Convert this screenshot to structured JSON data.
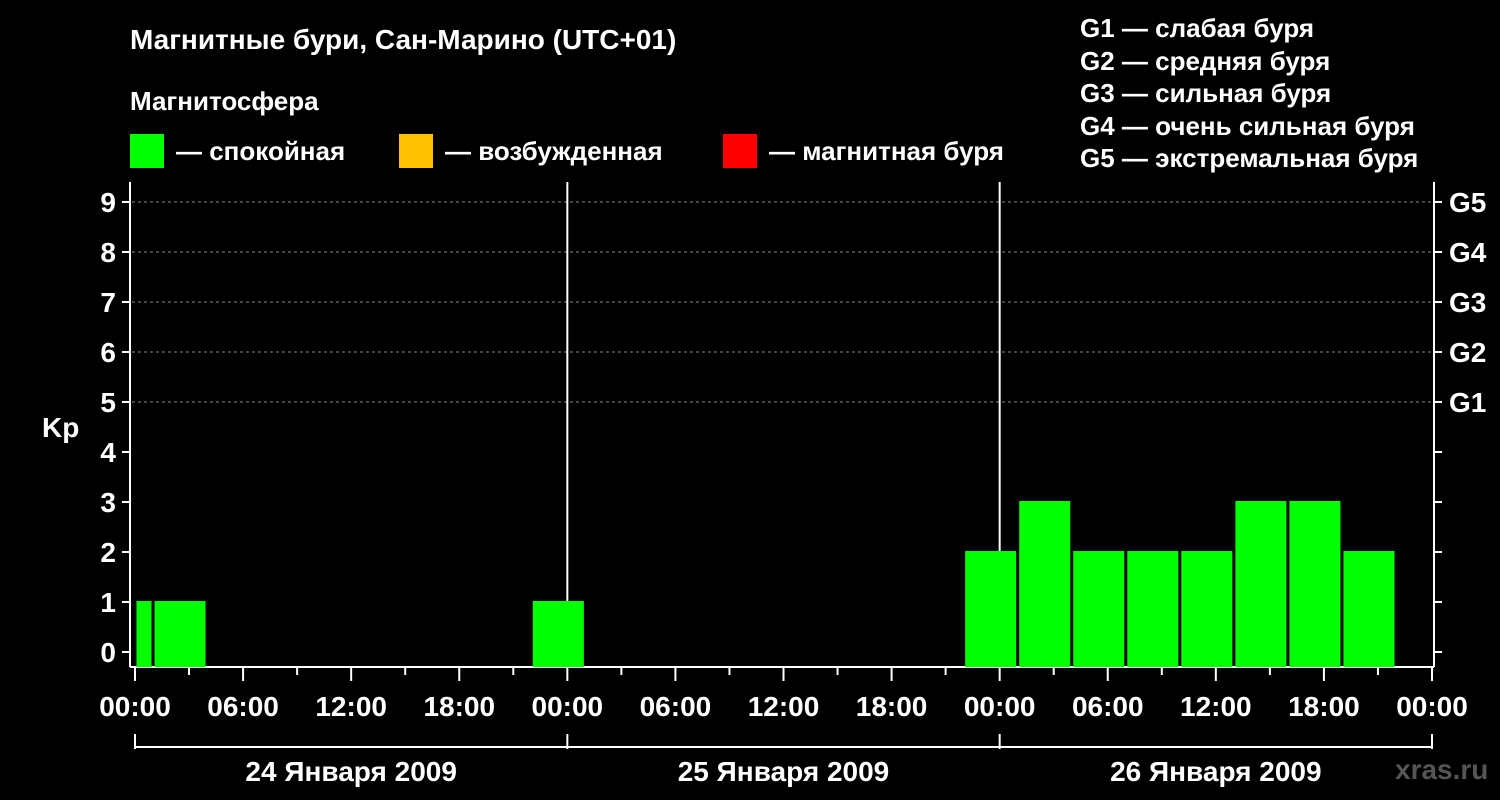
{
  "title": "Магнитные бури, Сан-Марино (UTC+01)",
  "magnetosphere_label": "Магнитосфера",
  "legend": [
    {
      "label": "— спокойная",
      "color": "#00ff00"
    },
    {
      "label": "— возбужденная",
      "color": "#ffc000"
    },
    {
      "label": "— магнитная буря",
      "color": "#ff0000"
    }
  ],
  "g_scale": [
    "G1 — слабая буря",
    "G2 — средняя буря",
    "G3 — сильная буря",
    "G4 — очень сильная буря",
    "G5 — экстремальная буря"
  ],
  "watermark": "xras.ru",
  "chart_data": {
    "type": "bar",
    "ylabel": "Kp",
    "ylim": [
      0,
      9
    ],
    "y_ticks": [
      "0",
      "1",
      "2",
      "3",
      "4",
      "5",
      "6",
      "7",
      "8",
      "9"
    ],
    "right_ticks": [
      {
        "kp": 5,
        "label": "G1"
      },
      {
        "kp": 6,
        "label": "G2"
      },
      {
        "kp": 7,
        "label": "G3"
      },
      {
        "kp": 8,
        "label": "G4"
      },
      {
        "kp": 9,
        "label": "G5"
      }
    ],
    "x_tick_labels": [
      "00:00",
      "06:00",
      "12:00",
      "18:00",
      "00:00",
      "06:00",
      "12:00",
      "18:00",
      "00:00",
      "06:00",
      "12:00",
      "18:00",
      "00:00"
    ],
    "days": [
      "24 Января 2009",
      "25 Января 2009",
      "26 Января 2009"
    ],
    "grid": "horizontal dashed at Kp 5-9",
    "bars": [
      {
        "start_hour": 0,
        "end_hour": 1,
        "kp": 1
      },
      {
        "start_hour": 1,
        "end_hour": 4,
        "kp": 1
      },
      {
        "start_hour": 22,
        "end_hour": 25,
        "kp": 1
      },
      {
        "start_hour": 46,
        "end_hour": 49,
        "kp": 2
      },
      {
        "start_hour": 49,
        "end_hour": 52,
        "kp": 3
      },
      {
        "start_hour": 52,
        "end_hour": 55,
        "kp": 2
      },
      {
        "start_hour": 55,
        "end_hour": 58,
        "kp": 2
      },
      {
        "start_hour": 58,
        "end_hour": 61,
        "kp": 2
      },
      {
        "start_hour": 61,
        "end_hour": 64,
        "kp": 3
      },
      {
        "start_hour": 64,
        "end_hour": 67,
        "kp": 3
      },
      {
        "start_hour": 67,
        "end_hour": 70,
        "kp": 2
      }
    ],
    "bar_color": "#00ff00"
  }
}
